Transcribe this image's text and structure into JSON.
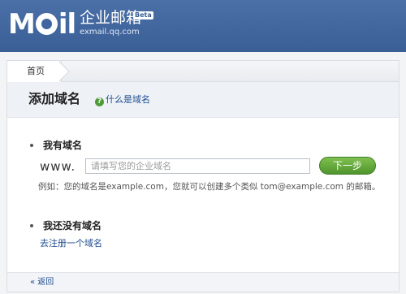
{
  "header": {
    "logo_text": "M",
    "logo_text2": "il",
    "brand_title": "企业邮箱",
    "beta_badge": "Beta",
    "domain": "exmail.qq.com"
  },
  "breadcrumb": {
    "home": "首页"
  },
  "page": {
    "title": "添加域名",
    "help_link": "什么是域名"
  },
  "have_domain": {
    "heading": "我有域名",
    "prefix": "www.",
    "input_placeholder": "请填写您的企业域名",
    "input_value": "",
    "next_button": "下一步",
    "example": "例如：您的域名是example.com，您就可以创建多个类似 tom@example.com 的邮箱。"
  },
  "no_domain": {
    "heading": "我还没有域名",
    "register_link": "去注册一个域名"
  },
  "footer": {
    "back_link": "« 返回"
  },
  "colors": {
    "header_blue": "#3f65a0",
    "button_green": "#5fa33a",
    "link_blue": "#1d4b8f"
  },
  "icons": [
    "help-icon",
    "bullet-icon"
  ]
}
